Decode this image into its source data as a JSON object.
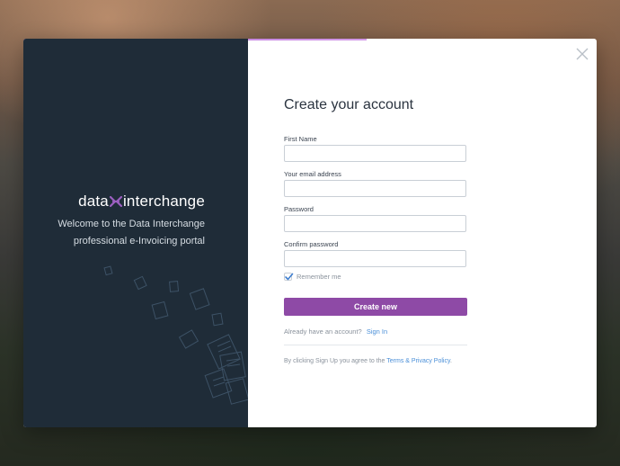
{
  "brand": {
    "logo_left": "data",
    "logo_right": "interchange",
    "welcome_line1": "Welcome to the Data Interchange",
    "welcome_line2": "professional e-Invoicing portal"
  },
  "form": {
    "title": "Create your account",
    "fields": [
      {
        "label": "First Name",
        "value": "",
        "placeholder": ""
      },
      {
        "label": "Your email address",
        "value": "",
        "placeholder": ""
      },
      {
        "label": "Password",
        "value": "",
        "placeholder": ""
      },
      {
        "label": "Confirm password",
        "value": "",
        "placeholder": ""
      }
    ],
    "remember_label": "Remember me",
    "remember_checked": true,
    "submit_label": "Create new",
    "already_text": "Already have an account?",
    "sign_in_link": "Sign In",
    "terms_prefix": "By clicking Sign Up you agree to the",
    "terms_link": "Terms & Privacy Policy",
    "terms_suffix": "."
  },
  "colors": {
    "left_panel": "#1f2c38",
    "accent": "#8e4aa6",
    "link": "#4a8fd8",
    "progress": "#b26bd8"
  },
  "icons": {
    "close": "close-icon",
    "checkbox": "check-icon",
    "logo_mark": "x-mark-icon"
  }
}
